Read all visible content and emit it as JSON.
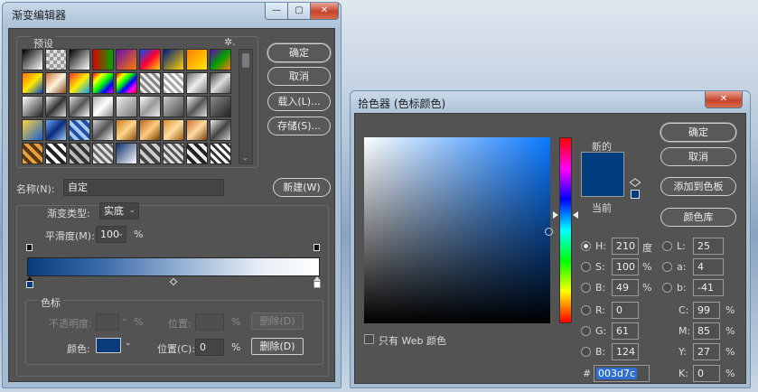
{
  "left": {
    "title": "渐变编辑器",
    "presets_label": "预设",
    "gear": "✲.",
    "swatches": [
      "linear-gradient(135deg,#000,#fff)",
      "repeating-conic-gradient(#999 0 25%,#ddd 0 50%) 0 0/8px 8px",
      "linear-gradient(135deg,#000,#fff)",
      "linear-gradient(90deg,#d00,#0a0)",
      "linear-gradient(135deg,#6a0dad,#ff7a00)",
      "linear-gradient(135deg,#004cff,#ff0033,#ffd400)",
      "linear-gradient(135deg,#001a80,#ffd400)",
      "linear-gradient(135deg,#ff7a00,#ffea00)",
      "linear-gradient(135deg,#6b00b3,#00a000,#ff7a00)",
      "linear-gradient(135deg,#ff6a00,#ffe600,#0044cc)",
      "linear-gradient(135deg,#c9702f,#fff3e0,#8a4b1e)",
      "linear-gradient(135deg,#ff3030,#ffee00,#00a0ff)",
      "linear-gradient(135deg,#ff0000,#ffff00,#00ff00,#0000ff,#ff00ff)",
      "linear-gradient(135deg,#f00,#ff0,#0f0,#00f,#f0f,#f00)",
      "repeating-linear-gradient(45deg,#888 0 3px,#eee 3px 6px)",
      "repeating-linear-gradient(45deg,#aaa 0 3px,#fff 3px 6px)",
      "linear-gradient(135deg,#666,#eee,#777)",
      "linear-gradient(135deg,#444,#ddd,#555)",
      "linear-gradient(135deg,#fff,#222)",
      "linear-gradient(135deg,#eee,#333,#ddd)",
      "linear-gradient(135deg,#ddd,#555,#fff)",
      "linear-gradient(135deg,#aaa,#fff,#888)",
      "linear-gradient(135deg,#eee,#777)",
      "linear-gradient(135deg,#fff,#999,#eee)",
      "linear-gradient(135deg,#ccc,#444)",
      "linear-gradient(135deg,#eee,#555,#ddd)",
      "linear-gradient(135deg,#888,#222)",
      "linear-gradient(135deg,#ffd23f,#1a5fd0)",
      "linear-gradient(135deg,#6aa8ff,#0a2a7a,#a8d0ff)",
      "repeating-linear-gradient(45deg,#1d4fa3 0 4px,#a9c8f0 4px 8px)",
      "linear-gradient(135deg,#cfcfcf,#555,#eee)",
      "linear-gradient(135deg,#c77a1a,#ffd58a,#8a4b0a)",
      "linear-gradient(135deg,#b5651d,#ffcc80,#7a3b00)",
      "linear-gradient(135deg,#d98b2b,#ffe0a0,#9a5a10)",
      "linear-gradient(135deg,#c8702a,#ffdaa0,#7a3b10)",
      "linear-gradient(135deg,#eee,#444,#ccc)",
      "repeating-linear-gradient(45deg,#e8a040 0 4px,#5a3a10 4px 8px)",
      "repeating-linear-gradient(45deg,#fff 0 4px,#222 4px 8px)",
      "repeating-linear-gradient(45deg,#bbb 0 4px,#333 4px 8px)",
      "repeating-linear-gradient(45deg,#ddd 0 3px,#666 3px 6px)",
      "linear-gradient(135deg,#0c2d6b,#fff)",
      "repeating-linear-gradient(45deg,#ccc 0 4px,#444 4px 8px)",
      "repeating-linear-gradient(45deg,#ddd 0 3px,#555 3px 6px)",
      "repeating-linear-gradient(45deg,#eee 0 4px,#222 4px 8px)",
      "repeating-linear-gradient(45deg,#fff 0 3px,#333 3px 6px)"
    ],
    "buttons": {
      "ok": "确定",
      "cancel": "取消",
      "load": "载入(L)...",
      "save": "存储(S)...",
      "new": "新建(W)"
    },
    "name_label": "名称(N):",
    "name_value": "自定",
    "type_label": "渐变类型:",
    "type_value": "实底",
    "smooth_label": "平滑度(M):",
    "smooth_value": "100",
    "smooth_unit": "%",
    "stops_label": "色标",
    "opacity_label": "不透明度:",
    "opacity_unit": "%",
    "location_label_top": "位置:",
    "location_unit_top": "%",
    "delete_top": "删除(D)",
    "color_label": "颜色:",
    "location_label": "位置(C):",
    "location_value": "0",
    "location_unit": "%",
    "delete_bottom": "删除(D)",
    "stop_color": "#0a3b7c",
    "gradient": "linear-gradient(90deg,#0a3c7e 0%,#3a6aa8 25%,#9db6d6 55%,#e8eef6 80%,#ffffff 100%)",
    "window_buttons": {
      "min": "—",
      "max": "▢",
      "close": "✕"
    }
  },
  "right": {
    "title": "拾色器 (色标颜色)",
    "close": "✕",
    "buttons": {
      "ok": "确定",
      "cancel": "取消",
      "add": "添加到色板",
      "libraries": "颜色库"
    },
    "new_label": "新的",
    "current_label": "当前",
    "new_color": "#003d7c",
    "current_color": "#003d7c",
    "web_only_label": "只有 Web 颜色",
    "fields": {
      "H": {
        "label": "H:",
        "value": "210",
        "unit": "度"
      },
      "S": {
        "label": "S:",
        "value": "100",
        "unit": "%"
      },
      "B": {
        "label": "B:",
        "value": "49",
        "unit": "%"
      },
      "R": {
        "label": "R:",
        "value": "0"
      },
      "G": {
        "label": "G:",
        "value": "61"
      },
      "Bl": {
        "label": "B:",
        "value": "124"
      },
      "L": {
        "label": "L:",
        "value": "25"
      },
      "a": {
        "label": "a:",
        "value": "4"
      },
      "b": {
        "label": "b:",
        "value": "-41"
      },
      "C": {
        "label": "C:",
        "value": "99",
        "unit": "%"
      },
      "M": {
        "label": "M:",
        "value": "85",
        "unit": "%"
      },
      "Y": {
        "label": "Y:",
        "value": "27",
        "unit": "%"
      },
      "K": {
        "label": "K:",
        "value": "0",
        "unit": "%"
      }
    },
    "hex_label": "#",
    "hex_value": "003d7c",
    "field_hue_color": "#0a78ff"
  }
}
